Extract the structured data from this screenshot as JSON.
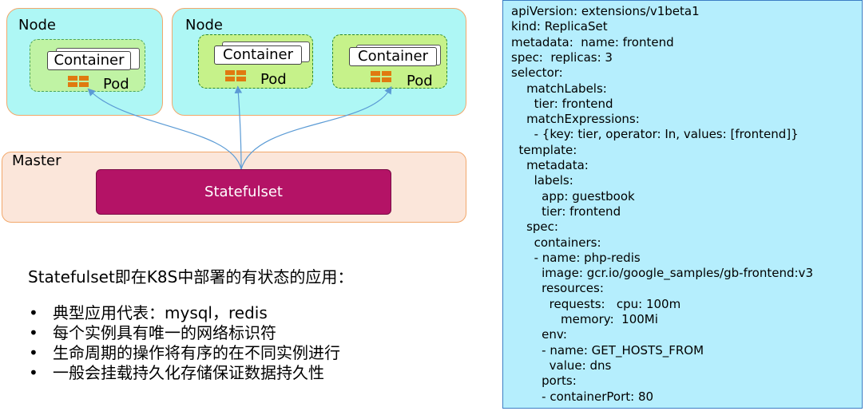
{
  "diagram": {
    "nodes": [
      {
        "label": "Node",
        "pods": [
          {
            "container_label": "Container",
            "pod_label": "Pod"
          }
        ]
      },
      {
        "label": "Node",
        "pods": [
          {
            "container_label": "Container",
            "pod_label": "Pod"
          },
          {
            "container_label": "Container",
            "pod_label": "Pod"
          }
        ]
      }
    ],
    "master": {
      "label": "Master",
      "statefulset_label": "Statefulset"
    },
    "colors": {
      "node_fill": "#aef7f5",
      "pod_fill": "#c6f28a",
      "master_fill": "#fbe6da",
      "statefulset_fill": "#b41366",
      "yaml_fill": "#b5eefd",
      "connector": "#5b9bd5"
    }
  },
  "description": {
    "title": "Statefulset即在K8S中部署的有状态的应用：",
    "bullets": [
      "典型应用代表：mysql，redis",
      "每个实例具有唯一的网络标识符",
      "生命周期的操作将有序的在不同实例进行",
      "一般会挂载持久化存储保证数据持久性"
    ]
  },
  "yaml": [
    "apiVersion: extensions/v1beta1",
    "kind: ReplicaSet",
    "metadata:  name: frontend",
    "spec:  replicas: 3",
    "selector:",
    "    matchLabels:",
    "      tier: frontend",
    "    matchExpressions:",
    "      - {key: tier, operator: In, values: [frontend]}",
    "  template:",
    "    metadata:",
    "      labels:",
    "        app: guestbook",
    "        tier: frontend",
    "    spec:",
    "      containers:",
    "      - name: php-redis",
    "        image: gcr.io/google_samples/gb-frontend:v3",
    "        resources:",
    "          requests:   cpu: 100m",
    "             memory:  100Mi",
    "        env:",
    "        - name: GET_HOSTS_FROM",
    "          value: dns",
    "        ports:",
    "        - containerPort: 80"
  ]
}
